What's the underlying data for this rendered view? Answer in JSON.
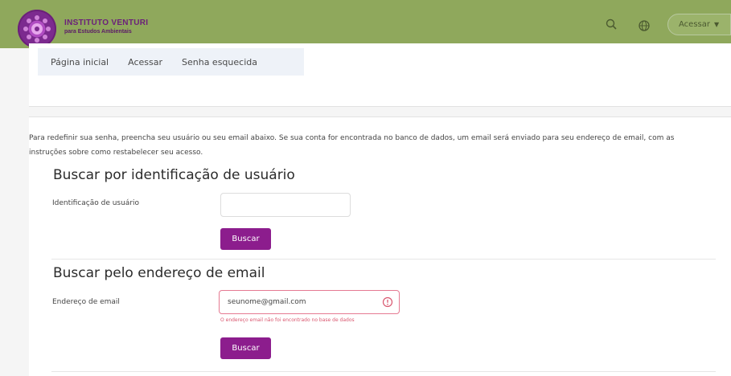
{
  "navbar": {
    "logo_line1": "INSTITUTO VENTURI",
    "logo_line2": "para Estudos Ambientais",
    "search_icon": "search-icon",
    "globe_icon": "globe-icon",
    "login_label": "Acessar",
    "brand_color": "#8fa85c",
    "accent_color": "#8c1d8d"
  },
  "tabs": [
    "Página inicial",
    "Acessar",
    "Senha esquecida"
  ],
  "intro_text": "Para redefinir sua senha, preencha seu usuário ou seu email abaixo. Se sua conta for encontrada no banco de dados, um email será enviado para seu endereço de email, com as instruções sobre como restabelecer seu acesso.",
  "section_username": {
    "heading": "Buscar por identificação de usuário",
    "label": "Identificação de usuário",
    "value": "",
    "button": "Buscar"
  },
  "section_email": {
    "heading": "Buscar pelo endereço de email",
    "label": "Endereço de email",
    "value": "seunome@gmail.com",
    "error": "O endereço email não foi encontrado no base de dados",
    "button": "Buscar"
  }
}
